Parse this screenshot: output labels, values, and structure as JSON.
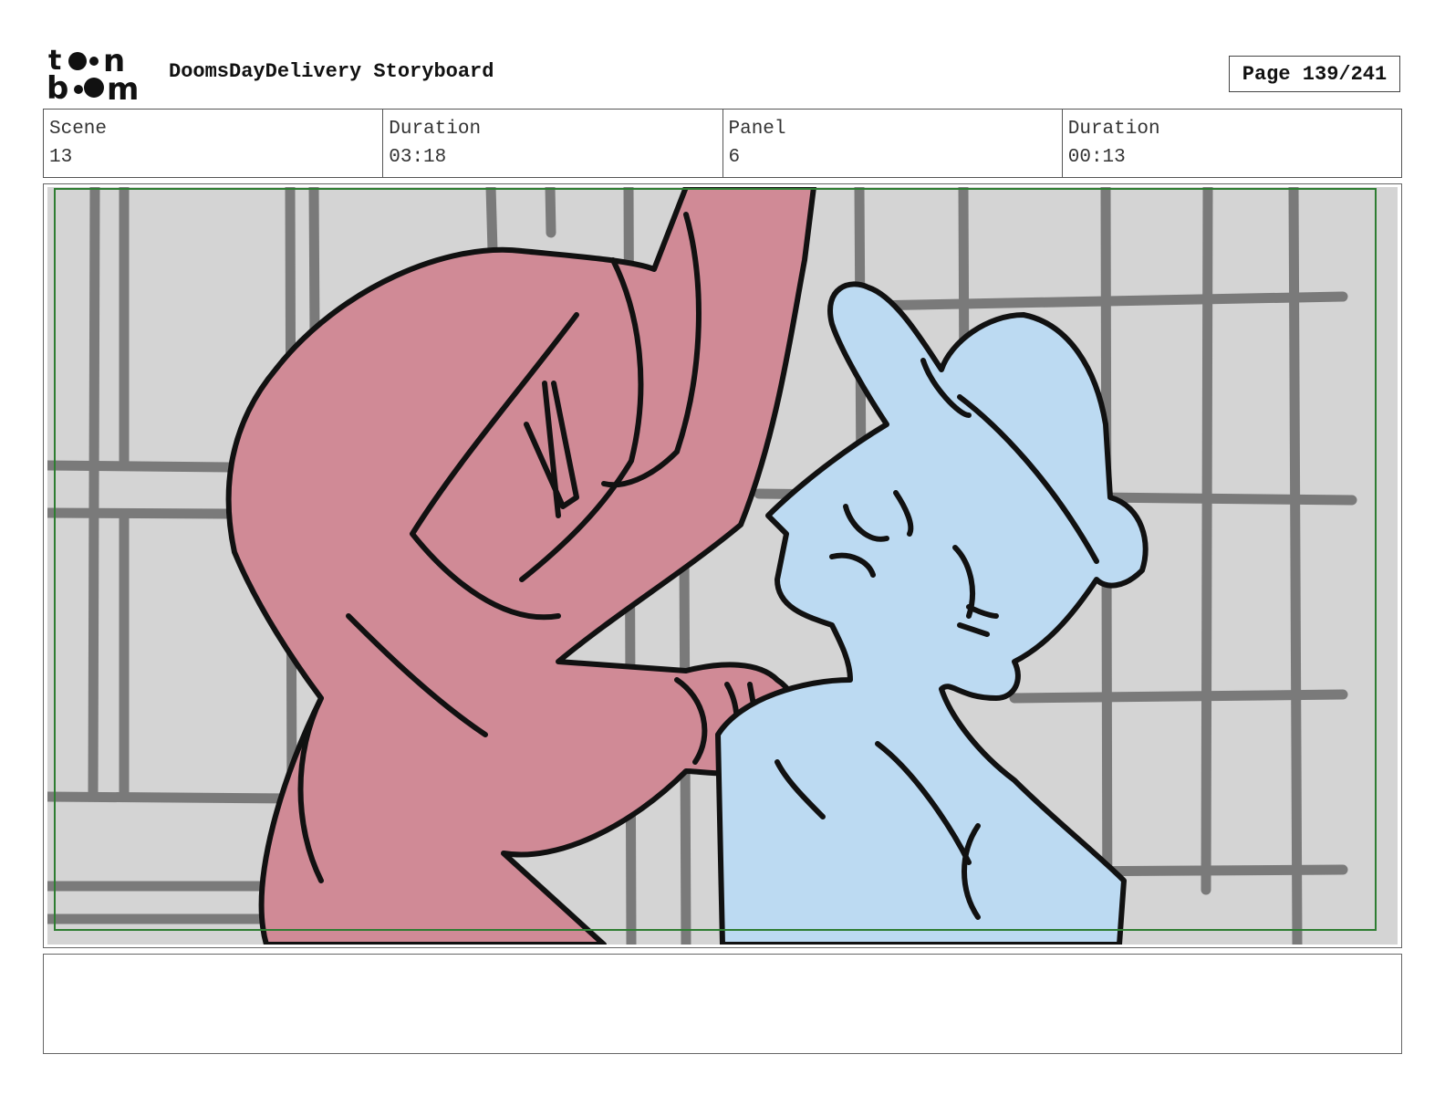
{
  "header": {
    "logo_text": "toon boom",
    "title": "DoomsDayDelivery Storyboard",
    "page": "Page 139/241"
  },
  "info": [
    {
      "label": "Scene",
      "value": "13"
    },
    {
      "label": "Duration",
      "value": "03:18"
    },
    {
      "label": "Panel",
      "value": "6"
    },
    {
      "label": "Duration",
      "value": "00:13"
    }
  ],
  "panel": {
    "colors": {
      "wall": "#d4d4d4",
      "grid": "#7a7a7a",
      "hooded_figure": "#d08a96",
      "delivery_character": "#bcdaf2",
      "ink": "#111111",
      "safe_frame": "#2e7d32"
    }
  },
  "notes": {
    "text": ""
  }
}
